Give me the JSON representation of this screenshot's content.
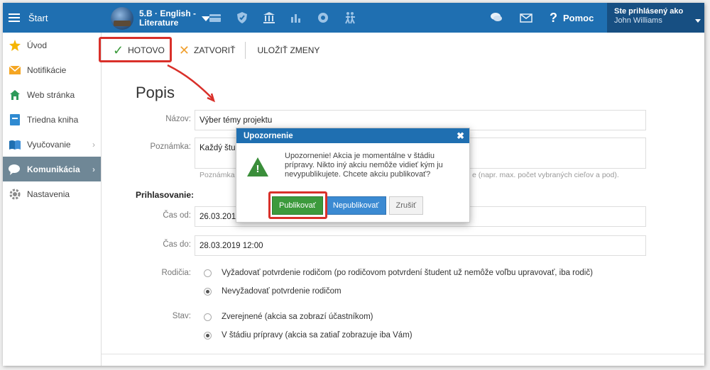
{
  "topbar": {
    "start_label": "Štart",
    "course_title": "5.B · English - Literature",
    "help_label": "Pomoc",
    "user_caption": "Ste prihlásený ako",
    "user_name": "John Williams",
    "icons": [
      "folder-icon",
      "shield-icon",
      "building-icon",
      "chart-icon",
      "award-icon",
      "people-icon",
      "chat-icon",
      "mail-icon"
    ]
  },
  "sidebar": {
    "items": [
      {
        "label": "Úvod",
        "icon": "star-icon"
      },
      {
        "label": "Notifikácie",
        "icon": "envelope-icon"
      },
      {
        "label": "Web stránka",
        "icon": "house-icon"
      },
      {
        "label": "Triedna kniha",
        "icon": "book-icon"
      },
      {
        "label": "Vyučovanie",
        "icon": "books-icon"
      },
      {
        "label": "Komunikácia",
        "icon": "speech-icon"
      },
      {
        "label": "Nastavenia",
        "icon": "gear-icon"
      }
    ]
  },
  "toolbar": {
    "done_label": "HOTOVO",
    "close_label": "ZATVORIŤ",
    "save_label": "ULOŽIŤ ZMENY"
  },
  "form": {
    "heading": "Popis",
    "name_label": "Názov:",
    "name_value": "Výber témy projektu",
    "note_label": "Poznámka:",
    "note_value": "Každý štu",
    "note_hint_left": "Poznámka",
    "note_hint_right": "e (napr. max. počet vybraných cieľov a pod).",
    "signup_heading": "Prihlasovanie:",
    "time_from_label": "Čas od:",
    "time_from_value": "26.03.201",
    "time_to_label": "Čas do:",
    "time_to_value": "28.03.2019 12:00",
    "parents_label": "Rodičia:",
    "parents_opt1": "Vyžadovať potvrdenie rodičom (po rodičovom potvrdení študent už nemôže voľbu upravovať, iba rodič)",
    "parents_opt2": "Nevyžadovať potvrdenie rodičom",
    "state_label": "Stav:",
    "state_opt1": "Zverejnené (akcia sa zobrazí účastníkom)",
    "state_opt2": "V štádiu prípravy (akcia sa zatiaľ zobrazuje iba Vám)"
  },
  "modal": {
    "title": "Upozornenie",
    "message": "Upozornenie! Akcia je momentálne v štádiu prípravy. Nikto iný akciu nemôže vidieť kým ju nevypublikujete. Chcete akciu publikovať?",
    "publish_label": "Publikovať",
    "unpublish_label": "Nepublikovať",
    "cancel_label": "Zrušiť"
  },
  "colors": {
    "brand_blue": "#1f6fb1",
    "highlight_red": "#d9302a",
    "success_green": "#3c9a3c"
  }
}
